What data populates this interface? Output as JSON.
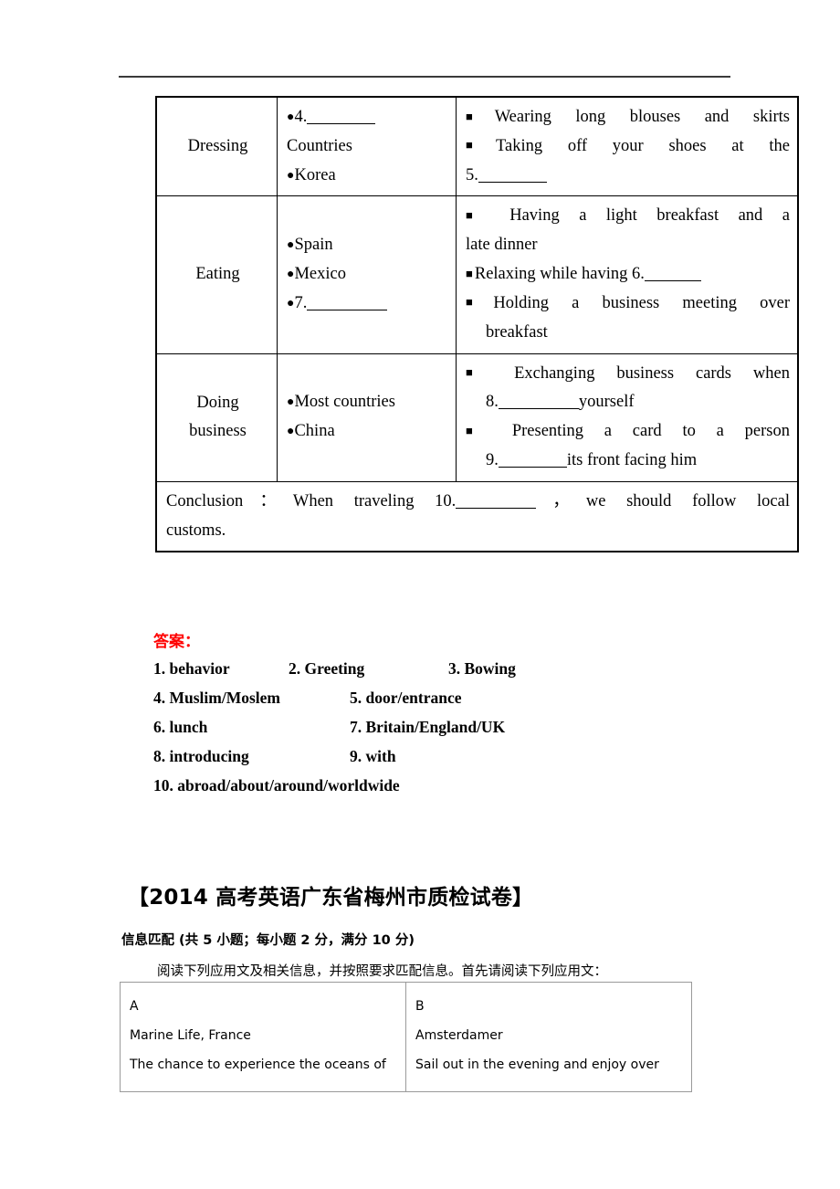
{
  "page": {
    "top_rule": "horizontal-rule"
  },
  "main_table": {
    "rows": [
      {
        "category": "Dressing",
        "middle": [
          {
            "bullet": "●",
            "text": "4.",
            "blank": "b-lg"
          },
          {
            "bullet": "",
            "text": "Countries",
            "blank": ""
          },
          {
            "bullet": "●",
            "text": "Korea",
            "blank": ""
          }
        ],
        "description": [
          {
            "bullet": "■",
            "text": "Wearing long blouses and skirts",
            "justify": true
          },
          {
            "bullet": "■",
            "text": "Taking off your shoes at the",
            "justify": true
          },
          {
            "bullet": "",
            "text": "5.",
            "blank": "b-lg",
            "justify": false
          }
        ]
      },
      {
        "category": "Eating",
        "middle": [
          {
            "bullet": "●",
            "text": "Spain",
            "blank": ""
          },
          {
            "bullet": "●",
            "text": "Mexico",
            "blank": ""
          },
          {
            "bullet": "●",
            "text": "7.",
            "blank": "b-xl"
          }
        ],
        "description": [
          {
            "bullet": "■",
            "text": "Having a light breakfast and a",
            "justify": true
          },
          {
            "bullet": "",
            "text": "late dinner",
            "justify": false
          },
          {
            "bullet": "■",
            "text": "Relaxing while having 6.",
            "blank": "b-md",
            "justify": false
          },
          {
            "bullet": "■",
            "text": "Holding a business meeting over",
            "justify": true
          },
          {
            "bullet": "",
            "text": "breakfast",
            "justify": false,
            "indent": true
          }
        ]
      },
      {
        "category": "Doing business",
        "middle": [
          {
            "bullet": "●",
            "text": "Most countries",
            "blank": ""
          },
          {
            "bullet": "●",
            "text": "China",
            "blank": ""
          }
        ],
        "description": [
          {
            "bullet": "■",
            "text": "Exchanging business cards when",
            "justify": true
          },
          {
            "bullet": "",
            "text": "8.",
            "blank": "b-xl",
            "tail": "yourself",
            "justify": false,
            "indent": true
          },
          {
            "bullet": "■",
            "text": "Presenting a card to a person",
            "justify": true
          },
          {
            "bullet": "",
            "text": "9.",
            "blank": "b-lg",
            "tail": "its front facing him",
            "justify": false,
            "indent": true
          }
        ]
      }
    ],
    "conclusion": {
      "label": "Conclusion",
      "line1_before": "：When traveling 10.",
      "line1_after": "，we should follow local",
      "line2": "customs."
    }
  },
  "answers": {
    "title": "答案：",
    "rows": [
      [
        "1. behavior",
        "2. Greeting",
        "3. Bowing"
      ],
      [
        "4. Muslim/Moslem",
        "5. door/entrance",
        ""
      ],
      [
        "6. lunch",
        "7. Britain/England/UK",
        ""
      ],
      [
        "8. introducing",
        "9. with",
        ""
      ],
      [
        "10. abroad/about/around/worldwide",
        "",
        ""
      ]
    ]
  },
  "section": {
    "heading": "【2014 高考英语广东省梅州市质检试卷】",
    "subtitle": "信息匹配 (共 5 小题；每小题 2 分，满分 10 分)",
    "instruction": "阅读下列应用文及相关信息，并按照要求匹配信息。首先请阅读下列应用文："
  },
  "ab_table": {
    "cells": [
      {
        "letter": "A",
        "title": "Marine Life, France",
        "body": "The chance to experience the oceans of"
      },
      {
        "letter": "B",
        "title": "Amsterdamer",
        "body": "Sail out in the evening and enjoy over"
      }
    ]
  }
}
